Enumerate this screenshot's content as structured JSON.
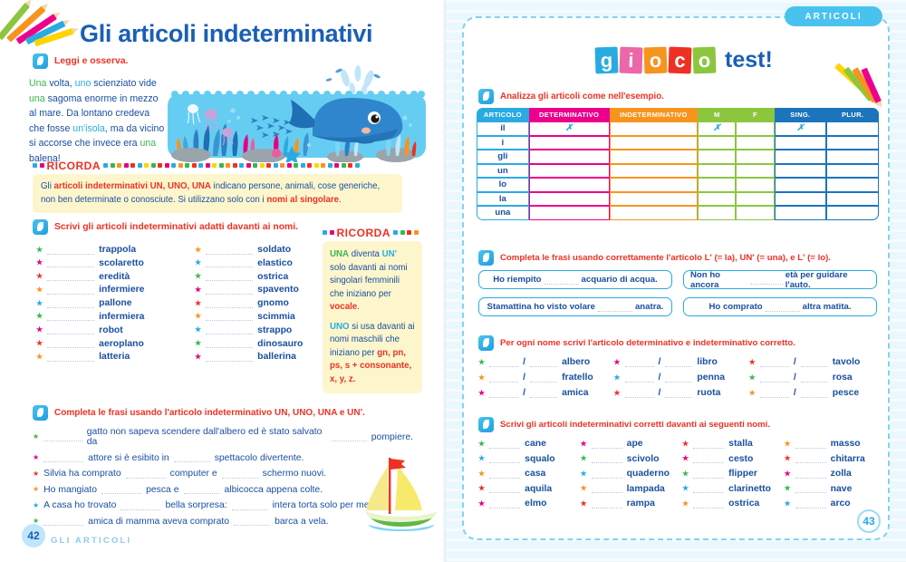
{
  "left_page": {
    "title": "Gli articoli indeterminativi",
    "read_exercise": {
      "icon": "pencil-icon",
      "label": "Leggi e osserva."
    },
    "story": [
      {
        "t": "Una ",
        "c": "green"
      },
      {
        "t": "volta, ",
        "c": "blue"
      },
      {
        "t": "uno ",
        "c": "cyan"
      },
      {
        "t": "scienziato vide ",
        "c": "blue"
      },
      {
        "t": "una ",
        "c": "green"
      },
      {
        "t": "sagoma enorme in mezzo al mare. Da lontano credeva che fosse ",
        "c": "blue"
      },
      {
        "t": "un'isola",
        "c": "cyan"
      },
      {
        "t": ", ma da vicino si accorse che invece era ",
        "c": "blue"
      },
      {
        "t": "una ",
        "c": "green"
      },
      {
        "t": "balena!",
        "c": "blue"
      }
    ],
    "story_plain": "Una volta, uno scienziato vide una sagoma enorme in mezzo al mare. Da lontano credeva che fosse un'isola, ma da vicino si accorse che invece era una balena!",
    "ricorda_1": {
      "heading": "RICORDA",
      "line1_a": "Gli ",
      "line1_b": "articoli indeterminativi UN, UNO, UNA",
      "line1_c": " indicano persone, animali, cose generiche,",
      "line2_a": "non ben determinate o conosciute. Si utilizzano solo con i ",
      "line2_b": "nomi al singolare",
      "line2_c": "."
    },
    "exercise_2": {
      "label": "Scrivi gli articoli indeterminativi adatti davanti ai nomi."
    },
    "words_col1": [
      "trappola",
      "scolaretto",
      "eredità",
      "infermiere",
      "pallone",
      "infermiera",
      "robot",
      "aeroplano",
      "latteria"
    ],
    "words_col2": [
      "soldato",
      "elastico",
      "ostrica",
      "spavento",
      "gnomo",
      "scimmia",
      "strappo",
      "dinosauro",
      "ballerina"
    ],
    "ricorda_2": {
      "heading": "RICORDA",
      "p1_a": "UNA",
      "p1_b": " diventa ",
      "p1_c": "UN'",
      "p1_d": " solo davanti ai nomi singolari femminili che iniziano per ",
      "p1_e": "vocale",
      "p1_f": ".",
      "p2_a": "UNO",
      "p2_b": " si usa davanti ai nomi maschili che iniziano per ",
      "p2_c": "gn, pn, ps,",
      "p2_d": "s + consonante,",
      "p2_e": "x, y, z."
    },
    "exercise_3": {
      "label": "Completa le frasi usando l'articolo indeterminativo UN, UNO, UNA e UN'."
    },
    "sentences": [
      {
        "parts": [
          "",
          "gatto non sapeva scendere dall'albero ed è stato salvato da",
          "pompiere."
        ]
      },
      {
        "parts": [
          "",
          "attore si è esibito in",
          "spettacolo divertente."
        ]
      },
      {
        "parts": [
          "Silvia ha comprato",
          "computer e",
          "schermo nuovi."
        ]
      },
      {
        "parts": [
          "Ho mangiato",
          "pesca e",
          "albicocca appena colte."
        ]
      },
      {
        "parts": [
          "A casa ho trovato",
          "bella sorpresa:",
          "intera torta solo per me!"
        ]
      },
      {
        "parts": [
          "",
          "amica di mamma aveva comprato",
          "barca a vela."
        ]
      }
    ],
    "illustration_sea": "whale-underwater-scene",
    "illustration_boat": "sailboat-illustration",
    "page_number": "42",
    "footer": "GLI ARTICOLI"
  },
  "right_page": {
    "tab_label": "ARTICOLI",
    "title_tiles": [
      {
        "ch": "g",
        "color": "#29abe2"
      },
      {
        "ch": "i",
        "color": "#ec67a8"
      },
      {
        "ch": "o",
        "color": "#f7941e"
      },
      {
        "ch": "c",
        "color": "#ee3124"
      },
      {
        "ch": "o",
        "color": "#8cc63f"
      }
    ],
    "title_word": "test!",
    "exercise_1": {
      "label": "Analizza gli articoli come nell'esempio."
    },
    "table": {
      "headers": [
        {
          "label": "ARTICOLO",
          "color": "#29abe2"
        },
        {
          "label": "DETERMINATIVO",
          "color": "#ec008c"
        },
        {
          "label": "INDETERMINATIVO",
          "color": "#f7941e"
        },
        {
          "label": "M",
          "color": "#8cc63f"
        },
        {
          "label": "F",
          "color": "#8cc63f"
        },
        {
          "label": "SING.",
          "color": "#1c75bc"
        },
        {
          "label": "PLUR.",
          "color": "#1c75bc"
        }
      ],
      "mark": "✗",
      "rows": [
        {
          "article": "il",
          "determinativo": "✗",
          "indeterminativo": "",
          "m": "✗",
          "f": "",
          "sing": "✗",
          "plur": ""
        },
        {
          "article": "i",
          "determinativo": "",
          "indeterminativo": "",
          "m": "",
          "f": "",
          "sing": "",
          "plur": ""
        },
        {
          "article": "gli",
          "determinativo": "",
          "indeterminativo": "",
          "m": "",
          "f": "",
          "sing": "",
          "plur": ""
        },
        {
          "article": "un",
          "determinativo": "",
          "indeterminativo": "",
          "m": "",
          "f": "",
          "sing": "",
          "plur": ""
        },
        {
          "article": "lo",
          "determinativo": "",
          "indeterminativo": "",
          "m": "",
          "f": "",
          "sing": "",
          "plur": ""
        },
        {
          "article": "la",
          "determinativo": "",
          "indeterminativo": "",
          "m": "",
          "f": "",
          "sing": "",
          "plur": ""
        },
        {
          "article": "una",
          "determinativo": "",
          "indeterminativo": "",
          "m": "",
          "f": "",
          "sing": "",
          "plur": ""
        }
      ]
    },
    "exercise_2": {
      "label": "Completa le frasi usando correttamente l'articolo L' (= la), UN' (= una), e L' (= lo)."
    },
    "pills": [
      {
        "before": "Ho riempito",
        "after": "acquario di acqua."
      },
      {
        "before": "Non ho ancora",
        "after": "età per guidare l'auto."
      },
      {
        "before": "Stamattina ho visto volare",
        "after": "anatra."
      },
      {
        "before": "Ho comprato",
        "after": "altra matita."
      }
    ],
    "exercise_3": {
      "label": "Per ogni nome scrivi l'articolo determinativo e indeterminativo corretto."
    },
    "pairs_cols": [
      [
        "albero",
        "fratello",
        "amica"
      ],
      [
        "libro",
        "penna",
        "ruota"
      ],
      [
        "tavolo",
        "rosa",
        "pesce"
      ]
    ],
    "exercise_4": {
      "label": "Scrivi gli articoli indeterminativi corretti davanti ai seguenti nomi."
    },
    "nouns_cols": [
      [
        "cane",
        "squalo",
        "casa",
        "aquila",
        "elmo"
      ],
      [
        "ape",
        "scivolo",
        "quaderno",
        "lampada",
        "rampa"
      ],
      [
        "stalla",
        "cesto",
        "flipper",
        "clarinetto",
        "ostrica"
      ],
      [
        "masso",
        "chitarra",
        "zolla",
        "nave",
        "arco"
      ]
    ],
    "page_number": "43"
  },
  "star_colors": [
    "#3bb54a",
    "#e6007e",
    "#ee3124",
    "#f7941e",
    "#29abe2"
  ],
  "pencil_colors": [
    "#8cc63f",
    "#f7941e",
    "#ec008c",
    "#29abe2",
    "#ffd400"
  ]
}
